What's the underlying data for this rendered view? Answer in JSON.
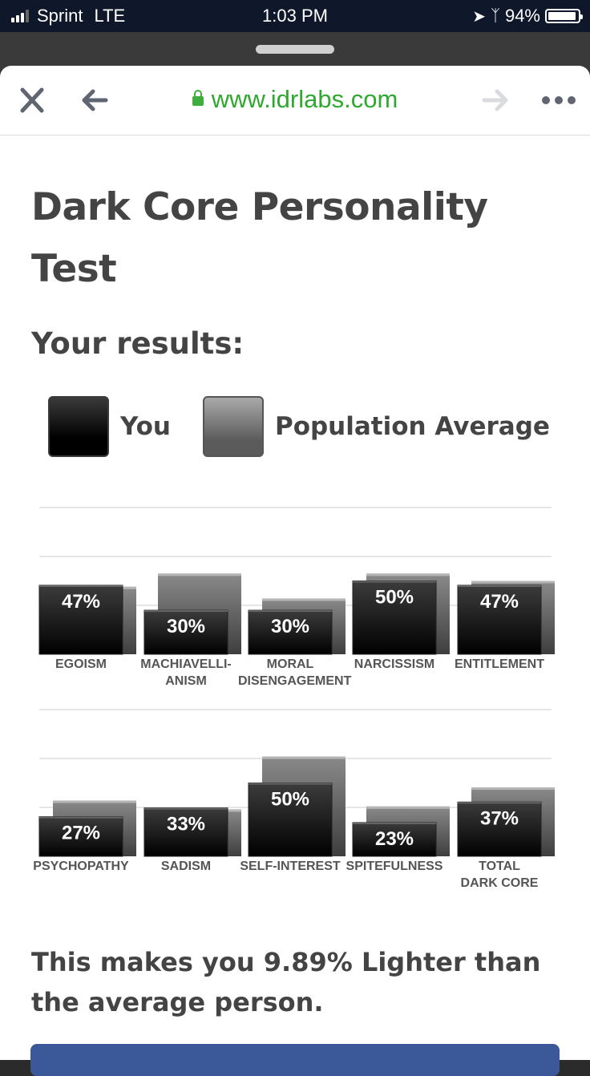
{
  "status_bar": {
    "carrier": "Sprint",
    "network": "LTE",
    "time": "1:03 PM",
    "battery": "94%",
    "battery_level": 0.94
  },
  "browser": {
    "url": "www.idrlabs.com",
    "close_icon": "close-icon",
    "back_icon": "back-arrow-icon",
    "forward_icon": "forward-arrow-icon",
    "more_icon": "more-icon"
  },
  "page": {
    "title": "Dark Core Personality Test",
    "results_heading": "Your results:",
    "legend": [
      {
        "label": "You"
      },
      {
        "label": "Population Average"
      }
    ],
    "summary": "This makes you 9.89% Lighter than the average person."
  },
  "chart_data": [
    {
      "type": "bar",
      "title": "",
      "xlabel": "",
      "ylabel": "",
      "ylim": [
        0,
        100
      ],
      "grid": true,
      "legend_position": "top",
      "categories": [
        "EGOISM",
        "MACHIAVELLI-\nANISM",
        "MORAL\nDISENGAGEMENT",
        "NARCISSISM",
        "ENTITLEMENT"
      ],
      "series": [
        {
          "name": "Population Average",
          "values": [
            46,
            55,
            38,
            55,
            50
          ]
        },
        {
          "name": "You",
          "values": [
            47,
            30,
            30,
            50,
            47
          ],
          "labels": [
            "47%",
            "30%",
            "30%",
            "50%",
            "47%"
          ]
        }
      ]
    },
    {
      "type": "bar",
      "title": "",
      "xlabel": "",
      "ylabel": "",
      "ylim": [
        0,
        100
      ],
      "grid": true,
      "legend_position": "top",
      "categories": [
        "PSYCHOPATHY",
        "SADISM",
        "SELF-INTEREST",
        "SPITEFULNESS",
        "TOTAL\nDARK CORE"
      ],
      "series": [
        {
          "name": "Population Average",
          "values": [
            38,
            32,
            68,
            34,
            47
          ]
        },
        {
          "name": "You",
          "values": [
            27,
            33,
            50,
            23,
            37
          ],
          "labels": [
            "27%",
            "33%",
            "50%",
            "23%",
            "37%"
          ]
        }
      ]
    }
  ]
}
